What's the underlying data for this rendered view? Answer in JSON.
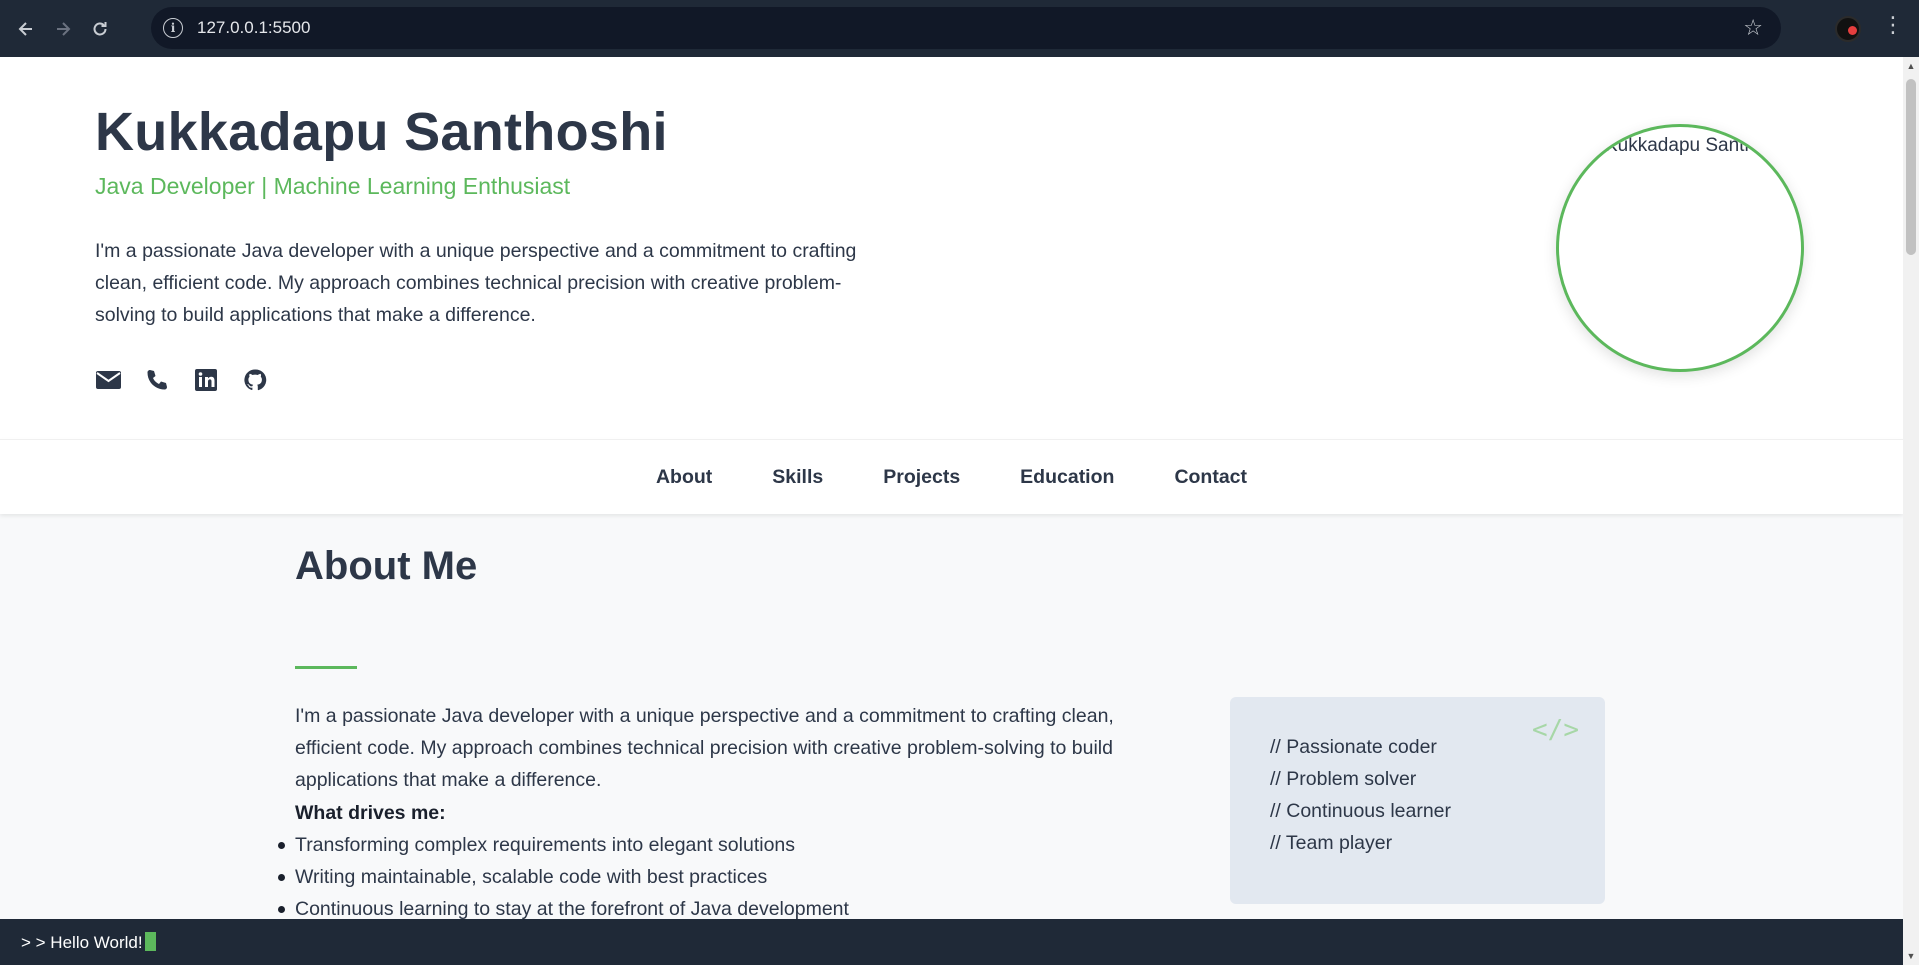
{
  "browser": {
    "url": "127.0.0.1:5500",
    "icons": [
      "back-icon",
      "forward-icon",
      "reload-icon",
      "info-icon",
      "star-icon",
      "profile-avatar",
      "menu-dots-icon"
    ]
  },
  "hero": {
    "name": "Kukkadapu Santhoshi",
    "tagline": "Java Developer | Machine Learning Enthusiast",
    "intro": "I'm a passionate Java developer with a unique perspective and a commitment to crafting clean, efficient code. My approach combines technical precision with creative problem-solving to build applications that make a difference.",
    "social_icons": [
      "envelope-icon",
      "phone-icon",
      "linkedin-icon",
      "github-icon"
    ],
    "photo_alt": "Kukkadapu Santhoshi"
  },
  "nav": {
    "items": [
      "About",
      "Skills",
      "Projects",
      "Education",
      "Contact"
    ]
  },
  "about": {
    "title": "About Me",
    "paragraph": "I'm a passionate Java developer with a unique perspective and a commitment to crafting clean, efficient code. My approach combines technical precision with creative problem-solving to build applications that make a difference.",
    "drives_label": "What drives me:",
    "drives": [
      "Transforming complex requirements into elegant solutions",
      "Writing maintainable, scalable code with best practices",
      "Continuous learning to stay at the forefront of Java development"
    ],
    "code_tag": "</>",
    "traits": [
      "// Passionate coder",
      "// Problem solver",
      "// Continuous learner",
      "// Team player"
    ]
  },
  "terminal": {
    "prompt": "> ",
    "text": "> Hello World!"
  },
  "colors": {
    "accent": "#5cb85c",
    "text": "#2d3748",
    "chrome": "#1f2937",
    "card": "#e2e8f0"
  }
}
